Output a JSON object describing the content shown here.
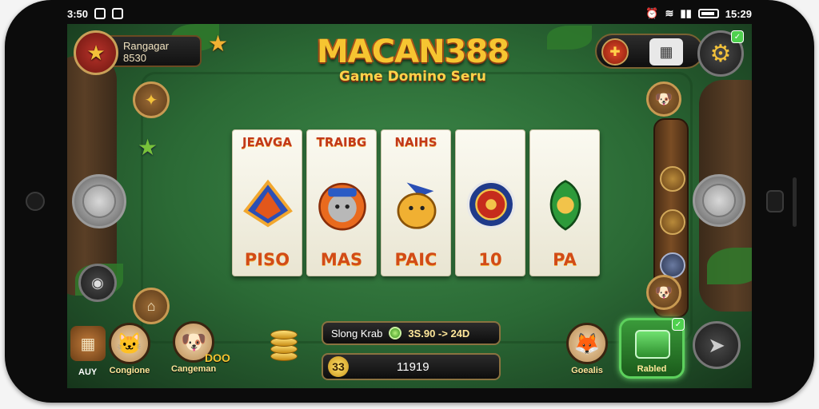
{
  "status_bar": {
    "left_text": "3:50",
    "right_text": "15:29"
  },
  "logo": {
    "title": "MACAN388",
    "subtitle": "Game Domino Seru"
  },
  "player": {
    "name": "Rangagar",
    "value": "8530"
  },
  "cards": [
    {
      "top": "JEAVGA",
      "bottom": "PISO",
      "art": "diamond"
    },
    {
      "top": "TRAIBG",
      "bottom": "MAS",
      "art": "cat-hat"
    },
    {
      "top": "NAIHS",
      "bottom": "PAIC",
      "art": "dog"
    },
    {
      "top": "",
      "bottom": "10",
      "art": "roulette"
    },
    {
      "top": "",
      "bottom": "PA",
      "art": "leaf-emblem"
    }
  ],
  "info_bar": {
    "label": "Slong Krab",
    "amount": "3S.90 -> 24D"
  },
  "bet_bar": {
    "icon_text": "33",
    "value": "11919"
  },
  "characters": {
    "left_a_label": "Congione",
    "left_b_label": "Cangeman",
    "left_b_tag": "DOO",
    "far_left_label": "AUY",
    "right_label": "Goealis"
  },
  "play_button": {
    "label": "Rabled"
  },
  "colors": {
    "felt": "#2b6a35",
    "gold": "#f6c531",
    "card_text": "#d24b17",
    "play_green": "#3a9a3a"
  }
}
